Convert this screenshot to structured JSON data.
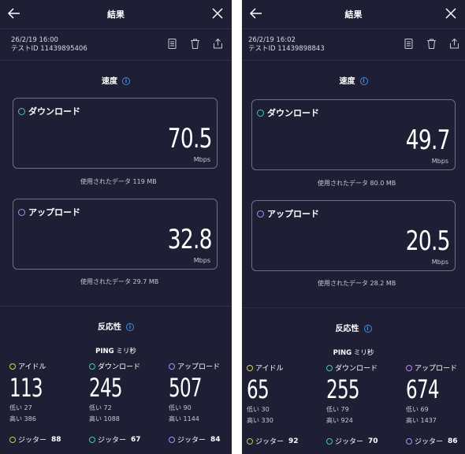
{
  "colors": {
    "background": "#1e1f35",
    "download": "#43c8b2",
    "upload": "#b58cf2",
    "idle": "#d6d84a",
    "info": "#3d8ee0"
  },
  "panels": [
    {
      "title": "結果",
      "datetime": "26/2/19 16:00",
      "test_id": "テストID 11439895406",
      "speed_title": "速度",
      "download": {
        "label": "ダウンロード",
        "value": "70.5",
        "unit": "Mbps",
        "used": "使用されたデータ 119 MB"
      },
      "upload": {
        "label": "アップロード",
        "value": "32.8",
        "unit": "Mbps",
        "used": "使用されたデータ 29.7 MB"
      },
      "resp_title": "反応性",
      "ping_label": "PING",
      "ping_unit": "ミリ秒",
      "idle": {
        "label": "アイドル",
        "value": "113",
        "low": "低い 27",
        "high": "高い 386",
        "jitter_label": "ジッター",
        "jitter": "88"
      },
      "dl": {
        "label": "ダウンロード",
        "value": "245",
        "low": "低い 72",
        "high": "高い 1088",
        "jitter_label": "ジッター",
        "jitter": "67"
      },
      "ul": {
        "label": "アップロード",
        "value": "507",
        "low": "低い 90",
        "high": "高い 1144",
        "jitter_label": "ジッター",
        "jitter": "84"
      }
    },
    {
      "title": "結果",
      "datetime": "26/2/19 16:02",
      "test_id": "テストID 11439898843",
      "speed_title": "速度",
      "download": {
        "label": "ダウンロード",
        "value": "49.7",
        "unit": "Mbps",
        "used": "使用されたデータ 80.0 MB"
      },
      "upload": {
        "label": "アップロード",
        "value": "20.5",
        "unit": "Mbps",
        "used": "使用されたデータ 28.2 MB"
      },
      "resp_title": "反応性",
      "ping_label": "PING",
      "ping_unit": "ミリ秒",
      "idle": {
        "label": "アイドル",
        "value": "65",
        "low": "低い 30",
        "high": "高い 330",
        "jitter_label": "ジッター",
        "jitter": "92"
      },
      "dl": {
        "label": "ダウンロード",
        "value": "255",
        "low": "低い 79",
        "high": "高い 924",
        "jitter_label": "ジッター",
        "jitter": "70"
      },
      "ul": {
        "label": "アップロード",
        "value": "674",
        "low": "低い 69",
        "high": "高い 1437",
        "jitter_label": "ジッター",
        "jitter": "86"
      }
    }
  ]
}
